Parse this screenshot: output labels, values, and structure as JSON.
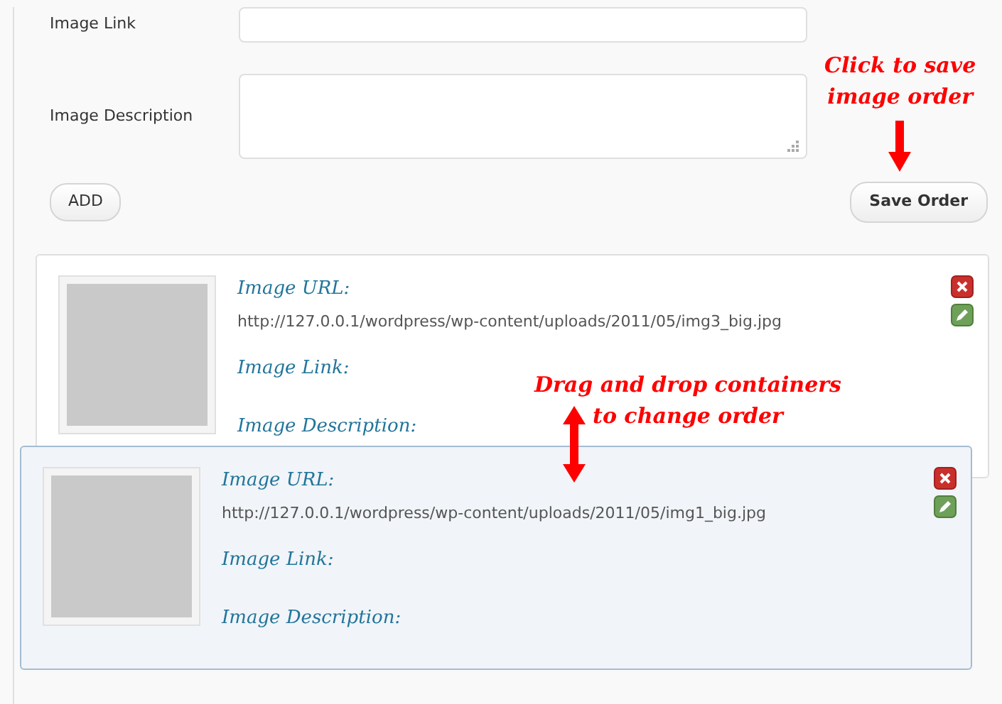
{
  "form": {
    "fields": [
      {
        "label": "Image Link",
        "kind": "input"
      },
      {
        "label": "Image Description",
        "kind": "textarea"
      }
    ],
    "add_button": "ADD",
    "save_button": "Save Order"
  },
  "cards": [
    {
      "url_label": "Image URL:",
      "url": "http://127.0.0.1/wordpress/wp-content/uploads/2011/05/img3_big.jpg",
      "link_label": "Image Link:",
      "description_label": "Image Description:",
      "dragging": false
    },
    {
      "url_label": "Image URL:",
      "url": "http://127.0.0.1/wordpress/wp-content/uploads/2011/05/img1_big.jpg",
      "link_label": "Image Link:",
      "description_label": "Image Description:",
      "dragging": true
    }
  ],
  "annotations": [
    {
      "lines": [
        "Click to save",
        "image order"
      ],
      "kind": "arrow-down"
    },
    {
      "lines": [
        "Drag and drop containers",
        "to change order"
      ],
      "kind": "double-arrow"
    }
  ]
}
